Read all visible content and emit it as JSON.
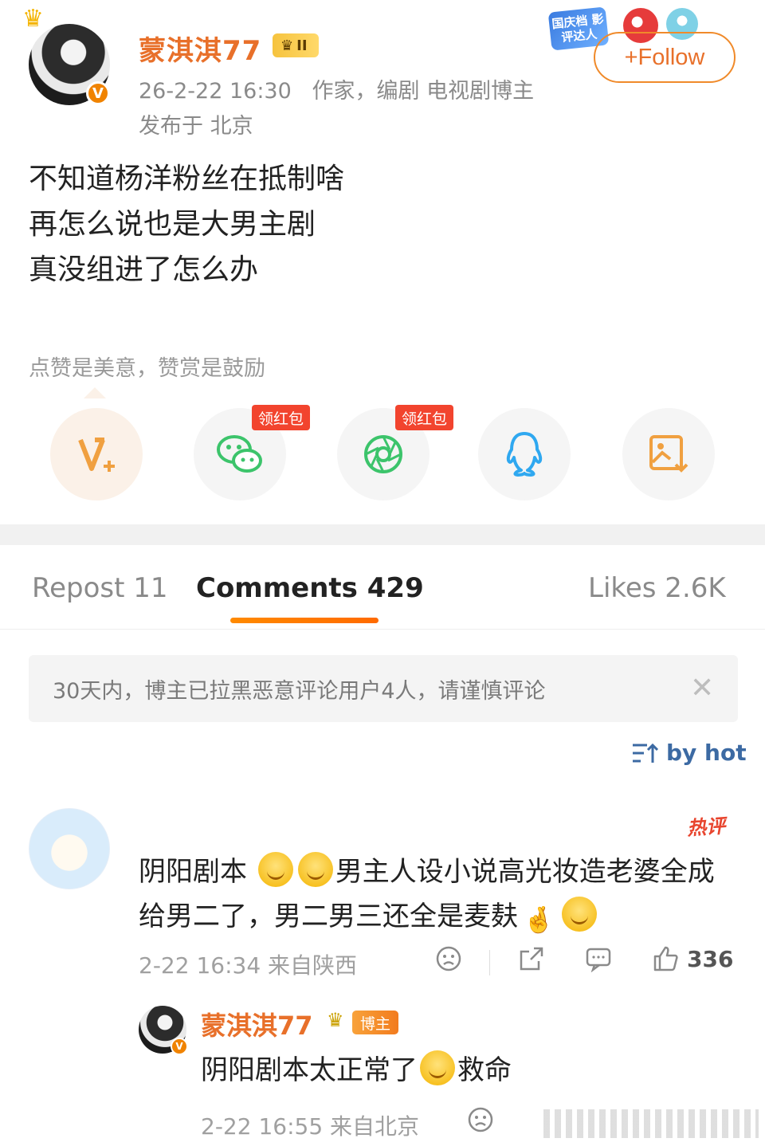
{
  "post": {
    "username": "蒙淇淇77",
    "level_badge": "II",
    "timestamp": "26-2-22 16:30",
    "identity": "作家，编剧 电视剧博主",
    "location": "发布于 北京",
    "follow_label": "+Follow",
    "event_badge_text": "国庆档 影评达人",
    "lines": [
      "不知道杨洋粉丝在抵制啥",
      "再怎么说也是大男主剧",
      "真没组进了怎么办"
    ]
  },
  "reward": {
    "tip_text": "点赞是美意，赞赏是鼓励",
    "share_buttons": [
      {
        "icon": "v-plus-icon",
        "color": "#f0a040"
      },
      {
        "icon": "wechat-icon",
        "color": "#3cc46b",
        "badge": "领红包"
      },
      {
        "icon": "moments-icon",
        "color": "#3cc46b",
        "badge": "领红包"
      },
      {
        "icon": "qq-icon",
        "color": "#2fa8f0"
      },
      {
        "icon": "save-image-icon",
        "color": "#f0a040"
      }
    ]
  },
  "tabs": [
    {
      "label": "Repost 11",
      "active": false
    },
    {
      "label": "Comments 429",
      "active": true
    },
    {
      "label": "Likes 2.6K",
      "active": false
    }
  ],
  "notice": "30天内，博主已拉黑恶意评论用户4人，请谨慎评论",
  "sort_label": "by hot",
  "comment": {
    "hot_tag": "热评",
    "text_parts": [
      "阴阳剧本",
      "男主人设小说高光妆造老婆全成给男二了，男二男三还全是麦麸"
    ],
    "timestamp": "2-22 16:34 来自陕西",
    "likes": "336"
  },
  "reply": {
    "username": "蒙淇淇77",
    "role_badge": "博主",
    "text_parts": [
      "阴阳剧本太正常了",
      "救命"
    ],
    "timestamp": "2-22 16:55 来自北京"
  },
  "colors": {
    "accent": "#e8702a",
    "link": "#3c6aa3",
    "muted": "#8a8a8a"
  }
}
